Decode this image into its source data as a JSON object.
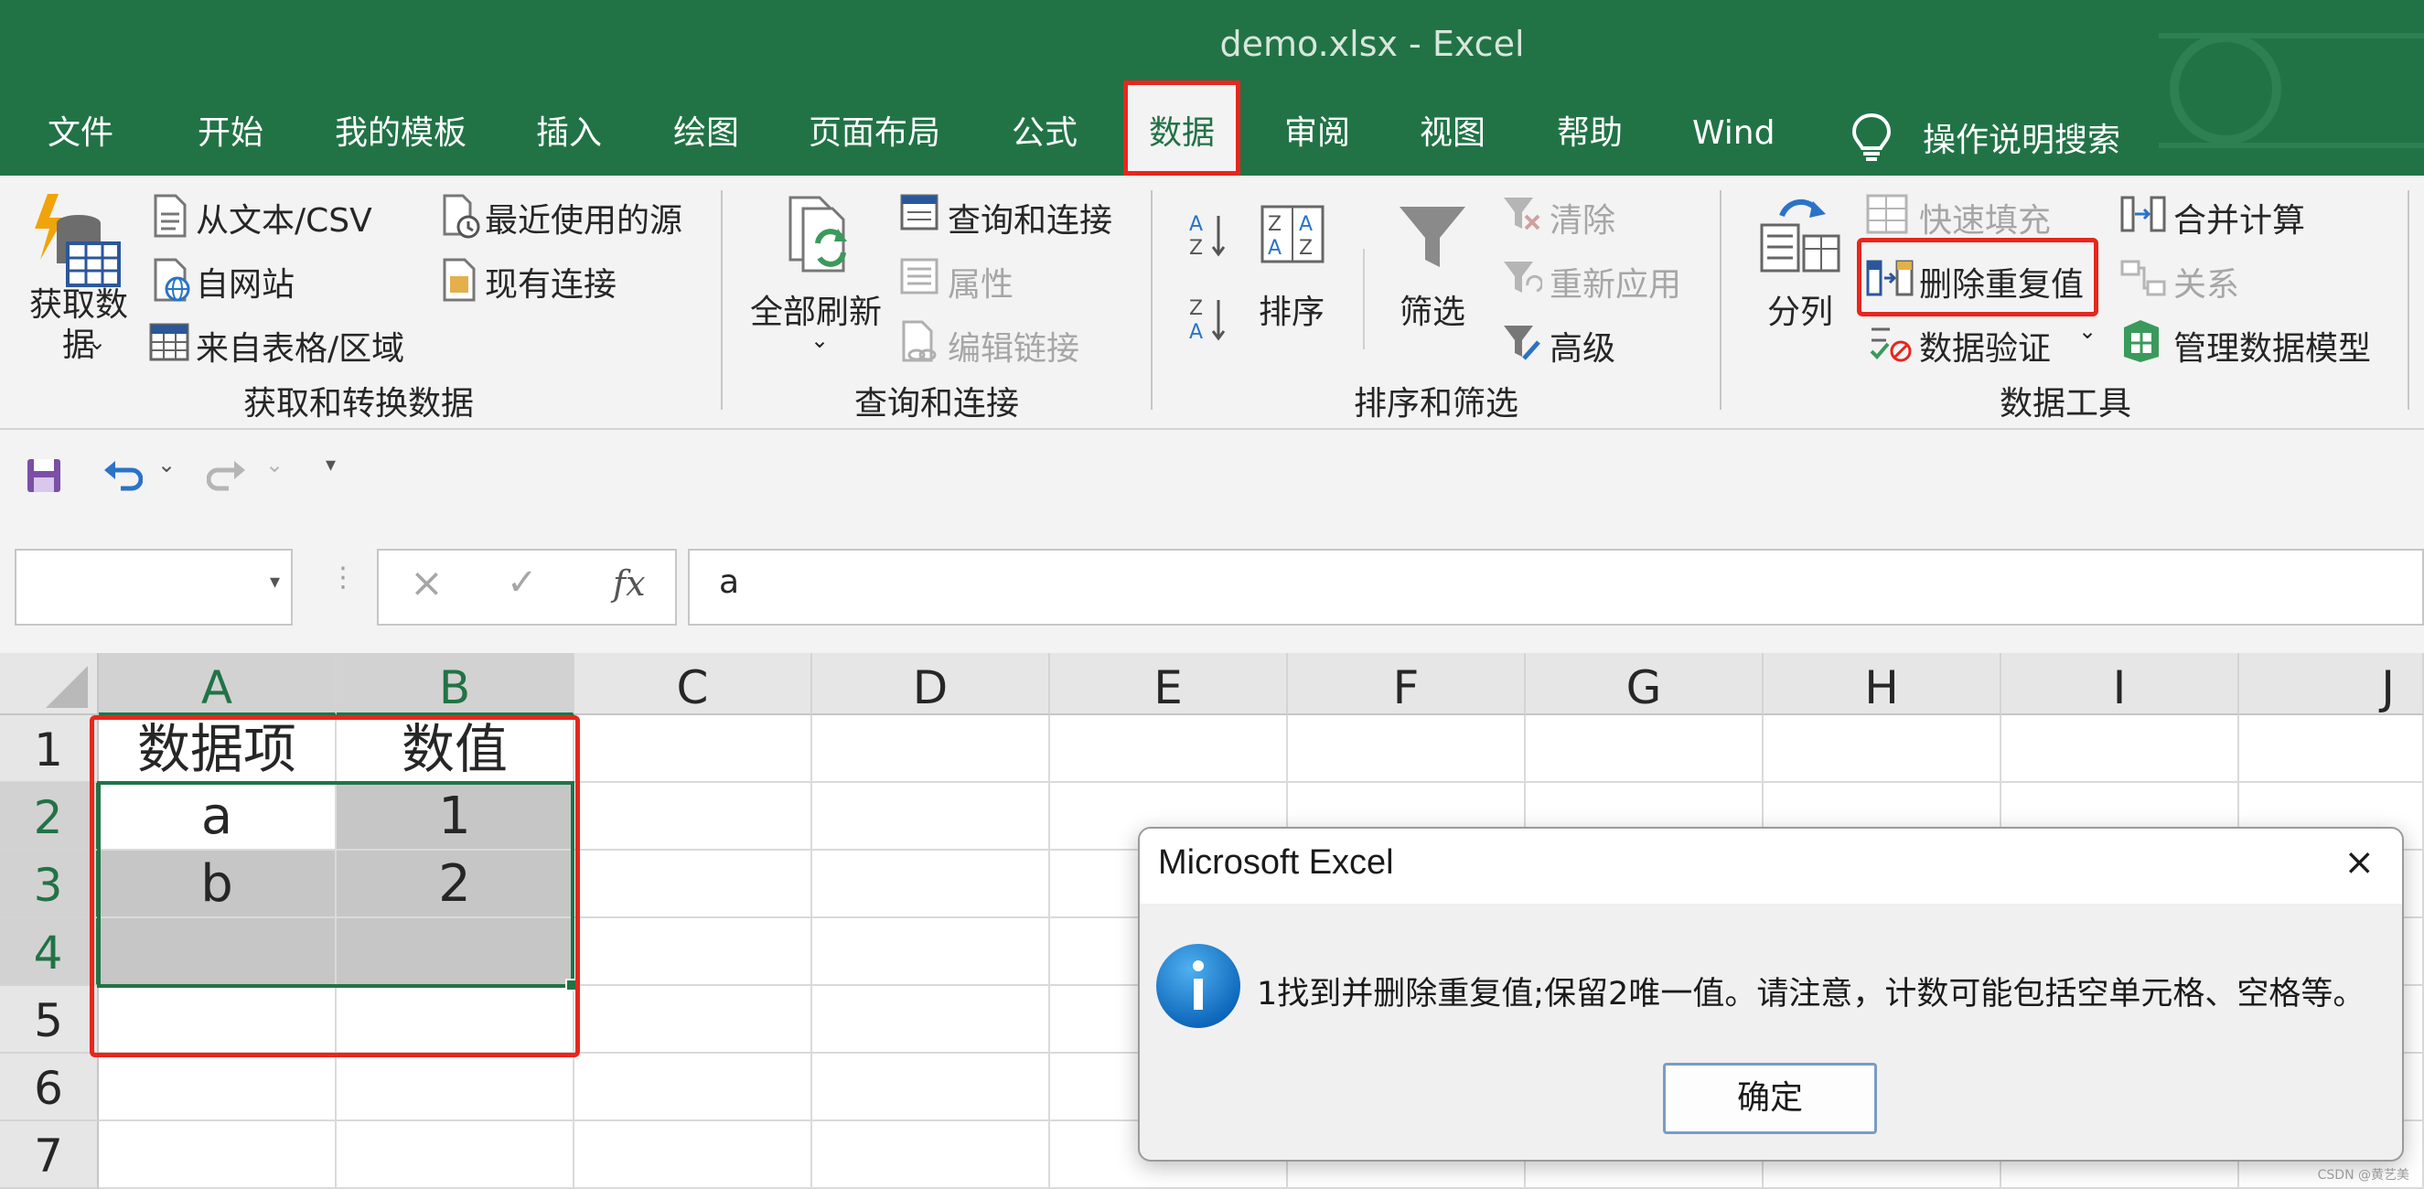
{
  "window": {
    "title": "demo.xlsx  -  Excel"
  },
  "tabs": [
    {
      "label": "文件"
    },
    {
      "label": "开始"
    },
    {
      "label": "我的模板"
    },
    {
      "label": "插入"
    },
    {
      "label": "绘图"
    },
    {
      "label": "页面布局"
    },
    {
      "label": "公式"
    },
    {
      "label": "数据"
    },
    {
      "label": "审阅"
    },
    {
      "label": "视图"
    },
    {
      "label": "帮助"
    },
    {
      "label": "Wind"
    }
  ],
  "tell_me": "操作说明搜索",
  "ribbon": {
    "get_data": {
      "big_button": "获取数\n据",
      "from_text": "从文本/CSV",
      "from_web": "自网站",
      "from_table": "来自表格/区域",
      "recent_sources": "最近使用的源",
      "existing_connections": "现有连接",
      "group_label": "获取和转换数据"
    },
    "queries": {
      "refresh_all": "全部刷新",
      "queries_connections": "查询和连接",
      "properties": "属性",
      "edit_links": "编辑链接",
      "group_label": "查询和连接"
    },
    "sort_filter": {
      "sort": "排序",
      "filter": "筛选",
      "clear": "清除",
      "reapply": "重新应用",
      "advanced": "高级",
      "group_label": "排序和筛选"
    },
    "data_tools": {
      "text_to_columns": "分列",
      "flash_fill": "快速填充",
      "remove_duplicates": "删除重复值",
      "data_validation": "数据验证",
      "consolidate": "合并计算",
      "relationships": "关系",
      "manage_data_model": "管理数据模型",
      "group_label": "数据工具"
    }
  },
  "formula_bar": {
    "name_box": "",
    "fx": "fx",
    "value": "a"
  },
  "grid": {
    "columns": [
      "A",
      "B",
      "C",
      "D",
      "E",
      "F",
      "G",
      "H",
      "I",
      "J"
    ],
    "rows": [
      "1",
      "2",
      "3",
      "4",
      "5",
      "6",
      "7"
    ],
    "cells": {
      "A1": "数据项",
      "B1": "数值",
      "A2": "a",
      "B2": "1",
      "A3": "b",
      "B3": "2"
    }
  },
  "dialog": {
    "title": "Microsoft Excel",
    "message": "1找到并删除重复值;保留2唯一值。请注意，计数可能包括空单元格、空格等。",
    "ok_label": "确定",
    "close_glyph": "×"
  },
  "colors": {
    "excel_green": "#217346",
    "highlight_red": "#e8261d",
    "selection_gray": "#c6c6c6"
  },
  "watermark": "CSDN @黄艺美"
}
